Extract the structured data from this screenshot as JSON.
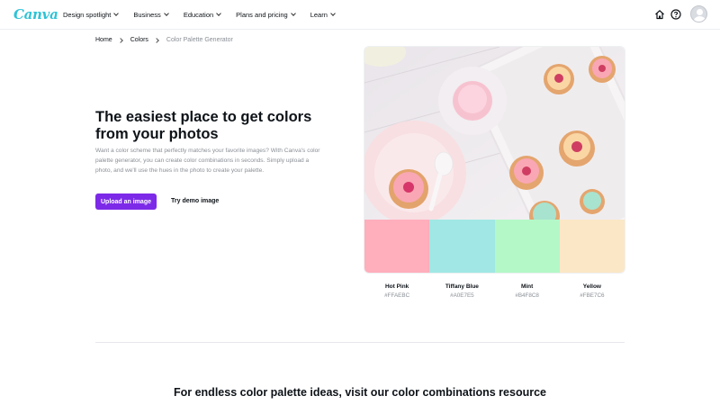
{
  "header": {
    "logo": "Canva",
    "nav": [
      {
        "label": "Design spotlight"
      },
      {
        "label": "Business"
      },
      {
        "label": "Education"
      },
      {
        "label": "Plans and pricing"
      },
      {
        "label": "Learn"
      }
    ],
    "icons": [
      "home-icon",
      "help-icon",
      "avatar"
    ]
  },
  "breadcrumb": {
    "items": [
      "Home",
      "Colors",
      "Color Palette Generator"
    ]
  },
  "hero": {
    "title": "The easiest place to get colors from your photos",
    "description": "Want a color scheme that perfectly matches your favorite images? With Canva's color palette generator, you can create color combinations in seconds. Simply upload a photo, and we'll use the hues in the photo to create your palette.",
    "upload_button": "Upload an image",
    "demo_button": "Try demo image"
  },
  "palette": [
    {
      "name": "Hot Pink",
      "hex": "#FFAEBC",
      "color": "#FFAEBC"
    },
    {
      "name": "Tiffany Blue",
      "hex": "#A0E7E5",
      "color": "#A0E7E5"
    },
    {
      "name": "Mint",
      "hex": "#B4F8C8",
      "color": "#B4F8C8"
    },
    {
      "name": "Yellow",
      "hex": "#FBE7C6",
      "color": "#FBE7C6"
    }
  ],
  "colors": {
    "accent": "#7d2ae8",
    "logo": "#2ec3d6"
  },
  "bottom": {
    "heading": "For endless color palette ideas, visit our color combinations resource"
  }
}
